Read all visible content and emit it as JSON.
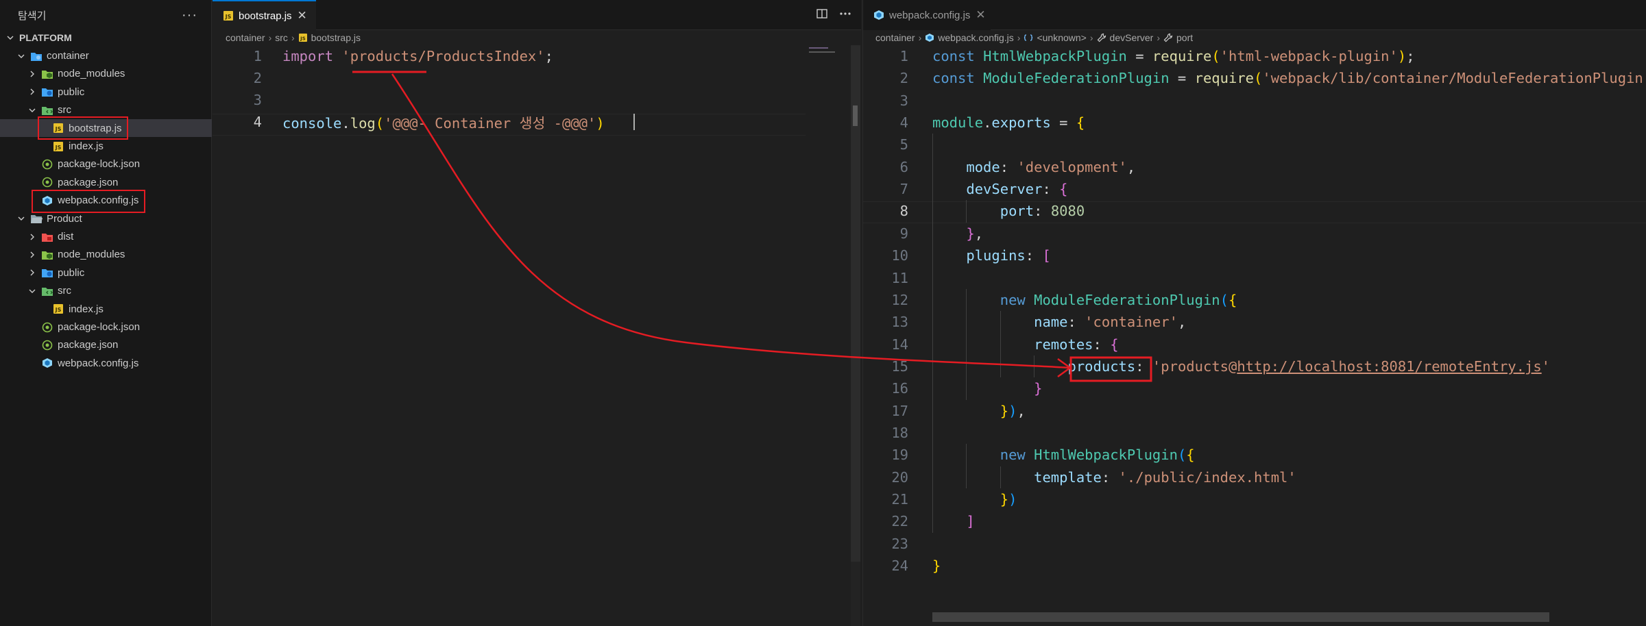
{
  "sidebar": {
    "title": "탐색기",
    "more_label": "···",
    "root_label": "PLATFORM",
    "items": [
      {
        "label": "container",
        "kind": "folder-open",
        "depth": 1,
        "icon": "container-folder-icon"
      },
      {
        "label": "node_modules",
        "kind": "folder",
        "depth": 2,
        "icon": "node-modules-folder-icon"
      },
      {
        "label": "public",
        "kind": "folder",
        "depth": 2,
        "icon": "public-folder-icon"
      },
      {
        "label": "src",
        "kind": "folder-open",
        "depth": 2,
        "icon": "src-folder-icon"
      },
      {
        "label": "bootstrap.js",
        "kind": "file",
        "depth": 3,
        "icon": "js-file-icon"
      },
      {
        "label": "index.js",
        "kind": "file",
        "depth": 3,
        "icon": "js-file-icon"
      },
      {
        "label": "package-lock.json",
        "kind": "file",
        "depth": 2,
        "icon": "npm-json-file-icon"
      },
      {
        "label": "package.json",
        "kind": "file",
        "depth": 2,
        "icon": "npm-json-file-icon"
      },
      {
        "label": "webpack.config.js",
        "kind": "file",
        "depth": 2,
        "icon": "webpack-file-icon"
      },
      {
        "label": "Product",
        "kind": "folder-open",
        "depth": 1,
        "icon": "folder-open-icon"
      },
      {
        "label": "dist",
        "kind": "folder",
        "depth": 2,
        "icon": "dist-folder-icon"
      },
      {
        "label": "node_modules",
        "kind": "folder",
        "depth": 2,
        "icon": "node-modules-folder-icon"
      },
      {
        "label": "public",
        "kind": "folder",
        "depth": 2,
        "icon": "public-folder-icon"
      },
      {
        "label": "src",
        "kind": "folder-open",
        "depth": 2,
        "icon": "src-folder-icon"
      },
      {
        "label": "index.js",
        "kind": "file",
        "depth": 3,
        "icon": "js-file-icon"
      },
      {
        "label": "package-lock.json",
        "kind": "file",
        "depth": 2,
        "icon": "npm-json-file-icon"
      },
      {
        "label": "package.json",
        "kind": "file",
        "depth": 2,
        "icon": "npm-json-file-icon"
      },
      {
        "label": "webpack.config.js",
        "kind": "file",
        "depth": 2,
        "icon": "webpack-file-icon"
      }
    ]
  },
  "left_editor": {
    "tab_label": "bootstrap.js",
    "tab_close": "✕",
    "breadcrumb": [
      "container",
      "src",
      "bootstrap.js"
    ],
    "active_line": 4,
    "lines": [
      [
        [
          "k",
          "import "
        ],
        [
          "s",
          "'products/ProductsIndex'"
        ],
        [
          "w",
          ";"
        ]
      ],
      [],
      [],
      [
        [
          "p",
          "console"
        ],
        [
          "w",
          "."
        ],
        [
          "f",
          "log"
        ],
        [
          "b1",
          "("
        ],
        [
          "s",
          "'@@@- Container 생성 -@@@'"
        ],
        [
          "b1",
          ")"
        ]
      ]
    ]
  },
  "right_editor": {
    "tab_label": "webpack.config.js",
    "tab_close": "✕",
    "breadcrumb": [
      "container",
      "webpack.config.js",
      "<unknown>",
      "devServer",
      "port"
    ],
    "active_line": 8,
    "lines": [
      [
        [
          "kb",
          "const "
        ],
        [
          "c",
          "HtmlWebpackPlugin"
        ],
        [
          "w",
          " = "
        ],
        [
          "f",
          "require"
        ],
        [
          "b1",
          "("
        ],
        [
          "s",
          "'html-webpack-plugin'"
        ],
        [
          "b1",
          ")"
        ],
        [
          "w",
          ";"
        ]
      ],
      [
        [
          "kb",
          "const "
        ],
        [
          "c",
          "ModuleFederationPlugin"
        ],
        [
          "w",
          " = "
        ],
        [
          "f",
          "require"
        ],
        [
          "b1",
          "("
        ],
        [
          "s",
          "'webpack/lib/container/ModuleFederationPlugin'"
        ],
        [
          "b1",
          ")"
        ],
        [
          "w",
          ";"
        ]
      ],
      [],
      [
        [
          "c",
          "module"
        ],
        [
          "w",
          "."
        ],
        [
          "p",
          "exports"
        ],
        [
          "w",
          " = "
        ],
        [
          "b1",
          "{"
        ]
      ],
      [],
      [
        [
          "w",
          "    "
        ],
        [
          "p",
          "mode"
        ],
        [
          "w",
          ": "
        ],
        [
          "s",
          "'development'"
        ],
        [
          "w",
          ","
        ]
      ],
      [
        [
          "w",
          "    "
        ],
        [
          "p",
          "devServer"
        ],
        [
          "w",
          ": "
        ],
        [
          "b2",
          "{"
        ]
      ],
      [
        [
          "w",
          "        "
        ],
        [
          "p",
          "port"
        ],
        [
          "w",
          ": "
        ],
        [
          "n",
          "8080"
        ]
      ],
      [
        [
          "w",
          "    "
        ],
        [
          "b2",
          "}"
        ],
        [
          "w",
          ","
        ]
      ],
      [
        [
          "w",
          "    "
        ],
        [
          "p",
          "plugins"
        ],
        [
          "w",
          ": "
        ],
        [
          "b2",
          "["
        ]
      ],
      [],
      [
        [
          "w",
          "        "
        ],
        [
          "kb",
          "new "
        ],
        [
          "c",
          "ModuleFederationPlugin"
        ],
        [
          "b3",
          "("
        ],
        [
          "b1",
          "{"
        ]
      ],
      [
        [
          "w",
          "            "
        ],
        [
          "p",
          "name"
        ],
        [
          "w",
          ": "
        ],
        [
          "s",
          "'container'"
        ],
        [
          "w",
          ","
        ]
      ],
      [
        [
          "w",
          "            "
        ],
        [
          "p",
          "remotes"
        ],
        [
          "w",
          ": "
        ],
        [
          "b2",
          "{"
        ]
      ],
      [
        [
          "w",
          "                "
        ],
        [
          "p",
          "products"
        ],
        [
          "w",
          ": "
        ],
        [
          "s",
          "'products@"
        ],
        [
          "sul",
          "http://localhost:8081/remoteEntry.js"
        ],
        [
          "s",
          "'"
        ]
      ],
      [
        [
          "w",
          "            "
        ],
        [
          "b2",
          "}"
        ]
      ],
      [
        [
          "w",
          "        "
        ],
        [
          "b1",
          "}"
        ],
        [
          "b3",
          ")"
        ],
        [
          "w",
          ","
        ]
      ],
      [],
      [
        [
          "w",
          "        "
        ],
        [
          "kb",
          "new "
        ],
        [
          "c",
          "HtmlWebpackPlugin"
        ],
        [
          "b3",
          "("
        ],
        [
          "b1",
          "{"
        ]
      ],
      [
        [
          "w",
          "            "
        ],
        [
          "p",
          "template"
        ],
        [
          "w",
          ": "
        ],
        [
          "s",
          "'./public/index.html'"
        ]
      ],
      [
        [
          "w",
          "        "
        ],
        [
          "b1",
          "}"
        ],
        [
          "b3",
          ")"
        ]
      ],
      [
        [
          "w",
          "    "
        ],
        [
          "b2",
          "]"
        ]
      ],
      [],
      [
        [
          "b1",
          "}"
        ]
      ]
    ]
  },
  "annotation": {
    "color": "#e51c23"
  }
}
